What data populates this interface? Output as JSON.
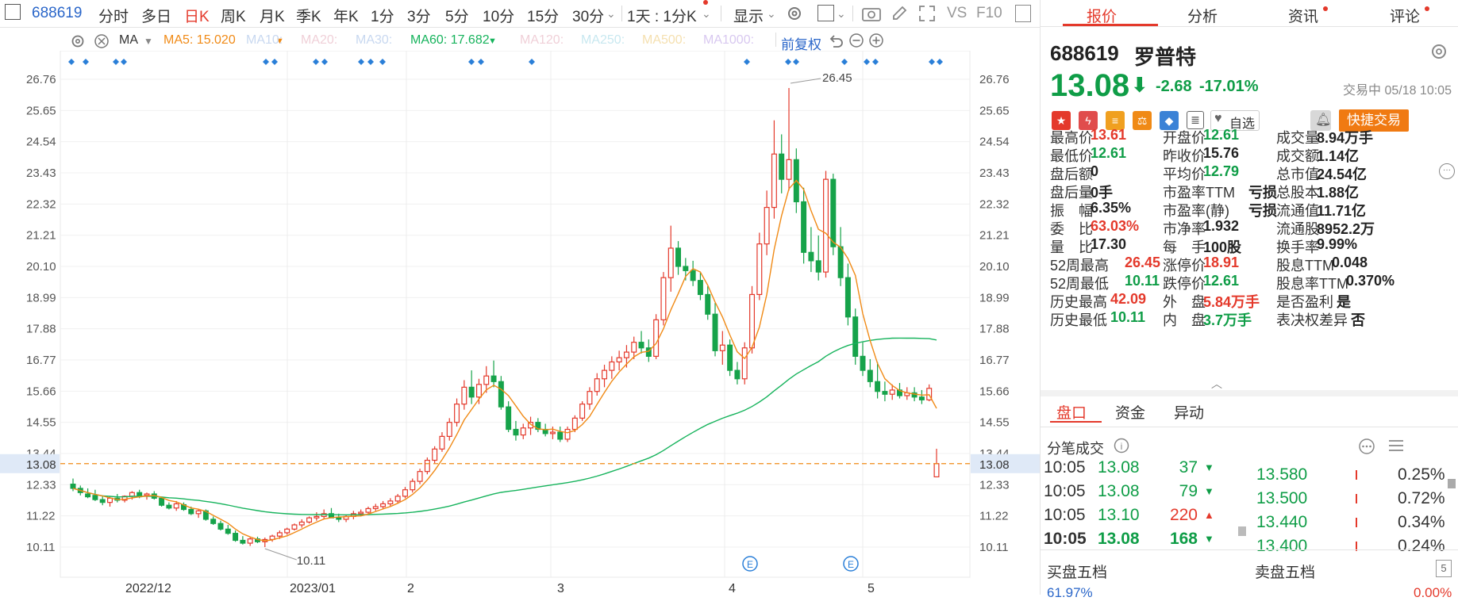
{
  "toolbar": {
    "code": "688619",
    "periods": [
      "分时",
      "多日",
      "日K",
      "周K",
      "月K",
      "季K",
      "年K",
      "1分",
      "3分",
      "5分",
      "10分",
      "15分",
      "30分"
    ],
    "active_period": "日K",
    "interval_select": "1天 : 1分K",
    "display_label": "显示",
    "vs_label": "VS",
    "f10_label": "F10"
  },
  "ma_legend": {
    "label": "MA",
    "ma5": "MA5: 15.020",
    "ma10": "MA10:",
    "ma20": "MA20:",
    "ma30": "MA30:",
    "ma60": "MA60: 17.682",
    "ma120": "MA120:",
    "ma250": "MA250:",
    "ma500": "MA500:",
    "ma1000": "MA1000:",
    "adjust": "前复权",
    "colors": {
      "ma5": "#f08a16",
      "ma60": "#16b35c",
      "faded": "#c8d8f0"
    }
  },
  "chart_data": {
    "type": "candlestick",
    "y_ticks": [
      "26.76",
      "25.65",
      "24.54",
      "23.43",
      "22.32",
      "21.21",
      "20.10",
      "18.99",
      "17.88",
      "16.77",
      "15.66",
      "14.55",
      "13.44",
      "12.33",
      "11.22",
      "10.11"
    ],
    "y_range": [
      10.11,
      26.76
    ],
    "x_labels": [
      "2022/12",
      "2023/01",
      "2",
      "3",
      "4",
      "5"
    ],
    "current_price": "13.08",
    "high_marker": "26.45",
    "low_marker": "10.11",
    "event_marker": "E",
    "up_color": "#e4392b",
    "down_color": "#16a34a",
    "candles": [
      [
        12.35,
        12.55,
        12.1,
        12.2
      ],
      [
        12.2,
        12.3,
        11.95,
        12.05
      ],
      [
        12.0,
        12.2,
        11.85,
        11.9
      ],
      [
        11.95,
        12.15,
        11.75,
        11.8
      ],
      [
        11.8,
        11.95,
        11.6,
        11.7
      ],
      [
        11.7,
        11.9,
        11.55,
        11.85
      ],
      [
        11.85,
        12.0,
        11.7,
        11.78
      ],
      [
        11.78,
        11.95,
        11.7,
        11.92
      ],
      [
        11.92,
        12.1,
        11.8,
        12.05
      ],
      [
        12.05,
        12.15,
        11.85,
        11.9
      ],
      [
        11.95,
        12.05,
        11.8,
        12.0
      ],
      [
        12.0,
        12.1,
        11.8,
        11.85
      ],
      [
        11.85,
        11.9,
        11.55,
        11.6
      ],
      [
        11.6,
        11.7,
        11.45,
        11.5
      ],
      [
        11.5,
        11.75,
        11.4,
        11.65
      ],
      [
        11.62,
        11.7,
        11.4,
        11.45
      ],
      [
        11.45,
        11.55,
        11.25,
        11.3
      ],
      [
        11.3,
        11.45,
        11.15,
        11.4
      ],
      [
        11.4,
        11.45,
        11.05,
        11.1
      ],
      [
        11.1,
        11.2,
        10.9,
        10.95
      ],
      [
        10.95,
        11.05,
        10.7,
        10.75
      ],
      [
        10.75,
        10.9,
        10.55,
        10.6
      ],
      [
        10.6,
        10.7,
        10.3,
        10.35
      ],
      [
        10.35,
        10.5,
        10.2,
        10.25
      ],
      [
        10.25,
        10.45,
        10.15,
        10.4
      ],
      [
        10.4,
        10.48,
        10.25,
        10.3
      ],
      [
        10.3,
        10.45,
        10.11,
        10.38
      ],
      [
        10.38,
        10.55,
        10.3,
        10.5
      ],
      [
        10.5,
        10.7,
        10.4,
        10.62
      ],
      [
        10.62,
        10.8,
        10.55,
        10.75
      ],
      [
        10.75,
        10.95,
        10.7,
        10.9
      ],
      [
        10.9,
        11.1,
        10.8,
        11.0
      ],
      [
        11.0,
        11.2,
        10.95,
        11.15
      ],
      [
        11.15,
        11.35,
        11.05,
        11.2
      ],
      [
        11.2,
        11.45,
        11.1,
        11.3
      ],
      [
        11.3,
        11.5,
        11.2,
        11.15
      ],
      [
        11.15,
        11.3,
        11.0,
        11.1
      ],
      [
        11.1,
        11.25,
        11.0,
        11.2
      ],
      [
        11.2,
        11.4,
        11.1,
        11.3
      ],
      [
        11.3,
        11.45,
        11.2,
        11.35
      ],
      [
        11.35,
        11.55,
        11.25,
        11.48
      ],
      [
        11.48,
        11.65,
        11.4,
        11.55
      ],
      [
        11.55,
        11.75,
        11.45,
        11.65
      ],
      [
        11.65,
        11.85,
        11.55,
        11.75
      ],
      [
        11.75,
        12.0,
        11.65,
        11.92
      ],
      [
        11.92,
        12.25,
        11.85,
        12.15
      ],
      [
        12.15,
        12.55,
        12.05,
        12.45
      ],
      [
        12.45,
        12.9,
        12.35,
        12.8
      ],
      [
        12.8,
        13.3,
        12.7,
        13.2
      ],
      [
        13.2,
        13.7,
        13.1,
        13.6
      ],
      [
        13.6,
        14.2,
        13.5,
        14.05
      ],
      [
        14.05,
        14.7,
        13.9,
        14.55
      ],
      [
        14.55,
        15.4,
        14.4,
        15.2
      ],
      [
        15.2,
        16.05,
        15.0,
        15.8
      ],
      [
        15.8,
        16.4,
        15.2,
        15.45
      ],
      [
        15.45,
        16.1,
        15.2,
        15.9
      ],
      [
        15.9,
        16.55,
        15.6,
        16.2
      ],
      [
        16.2,
        16.75,
        15.8,
        16.0
      ],
      [
        16.0,
        16.2,
        15.0,
        15.1
      ],
      [
        15.1,
        15.3,
        14.2,
        14.3
      ],
      [
        14.3,
        14.6,
        13.9,
        14.1
      ],
      [
        14.1,
        14.5,
        13.95,
        14.35
      ],
      [
        14.35,
        14.75,
        14.1,
        14.55
      ],
      [
        14.55,
        14.7,
        14.2,
        14.3
      ],
      [
        14.3,
        14.5,
        14.05,
        14.15
      ],
      [
        14.15,
        14.4,
        13.95,
        14.2
      ],
      [
        14.2,
        14.4,
        13.85,
        13.95
      ],
      [
        13.95,
        14.4,
        13.85,
        14.3
      ],
      [
        14.3,
        14.8,
        14.2,
        14.7
      ],
      [
        14.7,
        15.3,
        14.6,
        15.2
      ],
      [
        15.2,
        15.8,
        15.0,
        15.65
      ],
      [
        15.65,
        16.3,
        15.5,
        16.1
      ],
      [
        16.1,
        16.6,
        15.8,
        16.4
      ],
      [
        16.4,
        16.9,
        16.1,
        16.7
      ],
      [
        16.7,
        17.1,
        16.4,
        16.85
      ],
      [
        16.85,
        17.3,
        16.5,
        17.05
      ],
      [
        17.05,
        17.6,
        16.8,
        17.4
      ],
      [
        17.4,
        17.8,
        17.0,
        17.2
      ],
      [
        17.2,
        17.5,
        16.7,
        16.9
      ],
      [
        16.9,
        18.4,
        16.8,
        18.2
      ],
      [
        18.2,
        19.9,
        18.0,
        19.7
      ],
      [
        19.7,
        21.55,
        19.2,
        20.75
      ],
      [
        20.75,
        21.0,
        19.8,
        20.1
      ],
      [
        20.1,
        20.4,
        19.6,
        19.95
      ],
      [
        19.95,
        20.3,
        19.4,
        19.6
      ],
      [
        19.6,
        19.9,
        18.9,
        19.1
      ],
      [
        19.1,
        19.4,
        18.2,
        18.4
      ],
      [
        18.4,
        18.8,
        16.9,
        17.1
      ],
      [
        17.1,
        17.8,
        16.6,
        17.3
      ],
      [
        17.3,
        17.5,
        16.2,
        16.4
      ],
      [
        16.4,
        16.7,
        15.9,
        16.1
      ],
      [
        16.1,
        17.4,
        15.9,
        17.2
      ],
      [
        17.2,
        19.4,
        17.0,
        19.1
      ],
      [
        19.1,
        21.3,
        18.9,
        20.9
      ],
      [
        20.9,
        22.8,
        20.5,
        22.2
      ],
      [
        22.2,
        25.3,
        21.8,
        24.1
      ],
      [
        24.1,
        24.8,
        22.7,
        23.2
      ],
      [
        23.2,
        26.45,
        22.8,
        23.9
      ],
      [
        23.9,
        24.3,
        22.0,
        22.4
      ],
      [
        22.4,
        22.9,
        20.2,
        20.6
      ],
      [
        20.6,
        21.5,
        19.9,
        20.3
      ],
      [
        20.3,
        21.2,
        19.6,
        19.9
      ],
      [
        19.9,
        23.5,
        19.7,
        23.2
      ],
      [
        23.2,
        23.4,
        20.5,
        20.8
      ],
      [
        20.8,
        21.5,
        19.4,
        19.7
      ],
      [
        19.7,
        20.2,
        18.0,
        18.3
      ],
      [
        18.3,
        18.6,
        16.6,
        16.9
      ],
      [
        16.9,
        17.4,
        16.2,
        16.4
      ],
      [
        16.4,
        16.8,
        15.8,
        16.0
      ],
      [
        16.0,
        16.7,
        15.4,
        15.65
      ],
      [
        15.65,
        16.0,
        15.3,
        15.55
      ],
      [
        15.55,
        15.9,
        15.35,
        15.7
      ],
      [
        15.7,
        15.95,
        15.4,
        15.5
      ],
      [
        15.5,
        15.8,
        15.35,
        15.6
      ],
      [
        15.6,
        15.8,
        15.3,
        15.45
      ],
      [
        15.45,
        15.7,
        15.2,
        15.35
      ],
      [
        15.35,
        15.9,
        15.3,
        15.76
      ],
      [
        12.61,
        13.61,
        12.61,
        13.08
      ]
    ]
  },
  "panel": {
    "tabs": [
      "报价",
      "分析",
      "资讯",
      "评论"
    ],
    "active_tab": "报价",
    "code": "688619",
    "name": "罗普特",
    "price": "13.08",
    "change": "-2.68",
    "change_pct": "-17.01%",
    "status": "交易中 05/18 10:05",
    "watch_label": "自选",
    "fast_trade_label": "快捷交易",
    "stats": [
      [
        "最高价",
        "13.61",
        "red",
        "开盘价",
        "12.61",
        "green",
        "成交量",
        "8.94万手",
        "dark"
      ],
      [
        "最低价",
        "12.61",
        "green",
        "昨收价",
        "15.76",
        "dark",
        "成交额",
        "1.14亿",
        "dark"
      ],
      [
        "盘后额",
        "0",
        "dark",
        "平均价",
        "12.79",
        "green",
        "总市值",
        "24.54亿",
        "dark"
      ],
      [
        "盘后量",
        "0手",
        "dark",
        "市盈率TTM",
        "亏损",
        "dark",
        "总股本",
        "1.88亿",
        "dark"
      ],
      [
        "振　幅",
        "6.35%",
        "dark",
        "市盈率(静)",
        "亏损",
        "dark",
        "流通值",
        "11.71亿",
        "dark"
      ],
      [
        "委　比",
        "63.03%",
        "red",
        "市净率",
        "1.932",
        "dark",
        "流通股",
        "8952.2万",
        "dark"
      ],
      [
        "量　比",
        "17.30",
        "dark",
        "每　手",
        "100股",
        "dark",
        "换手率",
        "9.99%",
        "dark"
      ],
      [
        "52周最高",
        "26.45",
        "red",
        "涨停价",
        "18.91",
        "red",
        "股息TTM",
        "0.048",
        "dark"
      ],
      [
        "52周最低",
        "10.11",
        "green",
        "跌停价",
        "12.61",
        "green",
        "股息率TTM",
        "0.370%",
        "dark"
      ],
      [
        "历史最高",
        "42.09",
        "red",
        "外　盘",
        "5.84万手",
        "red",
        "是否盈利",
        "是",
        "dark"
      ],
      [
        "历史最低",
        "10.11",
        "green",
        "内　盘",
        "3.7万手",
        "green",
        "表决权差异",
        "否",
        "dark"
      ]
    ],
    "subtabs": [
      "盘口",
      "资金",
      "异动"
    ],
    "trades_title": "分笔成交",
    "trades": [
      [
        "10:05",
        "13.08",
        "37",
        "down"
      ],
      [
        "10:05",
        "13.08",
        "79",
        "down"
      ],
      [
        "10:05",
        "13.10",
        "220",
        "up"
      ],
      [
        "10:05",
        "13.08",
        "168",
        "down"
      ]
    ],
    "orderbook": [
      [
        "13.580",
        "0.25%"
      ],
      [
        "13.500",
        "0.72%"
      ],
      [
        "13.440",
        "0.34%"
      ],
      [
        "13.400",
        "0.24%"
      ]
    ],
    "bid_title": "买盘五档",
    "ask_title": "卖盘五档",
    "bid_pct": "61.97%",
    "ask_pct": "0.00%"
  }
}
